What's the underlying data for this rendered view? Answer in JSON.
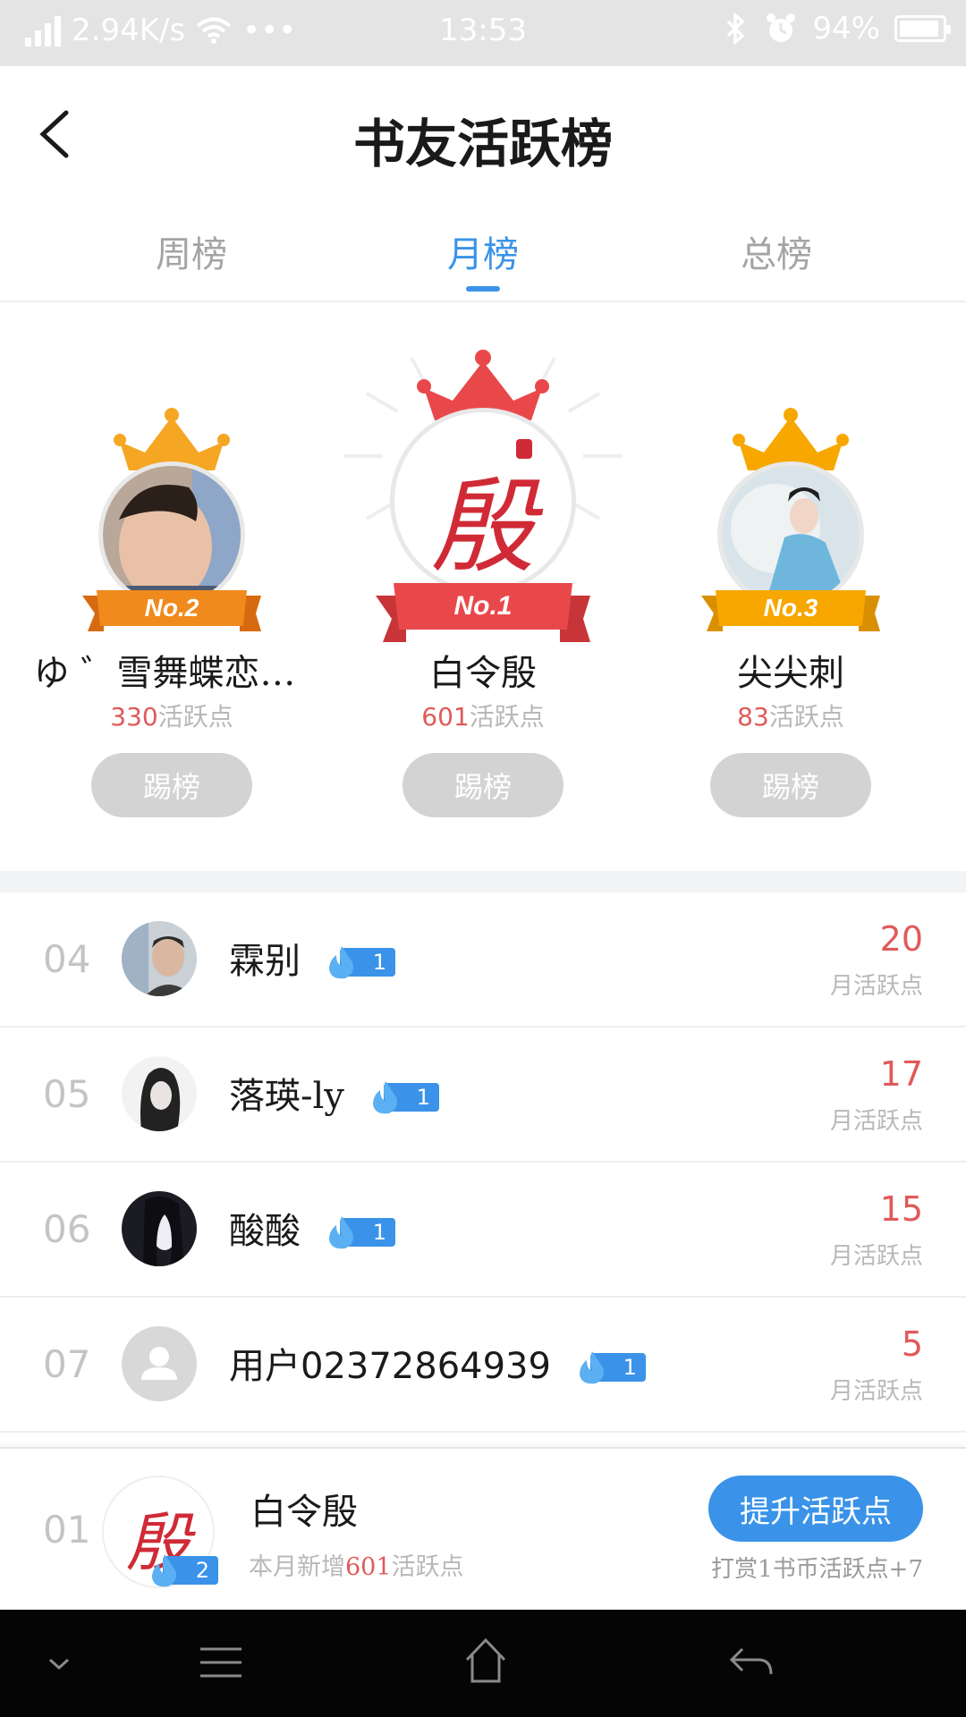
{
  "status_bar": {
    "net_speed": "2.94K/s",
    "more": "•••",
    "time": "13:53",
    "battery": "94%",
    "battery_level": 0.94
  },
  "header": {
    "title": "书友活跃榜"
  },
  "tabs": [
    {
      "label": "周榜",
      "active": false
    },
    {
      "label": "月榜",
      "active": true
    },
    {
      "label": "总榜",
      "active": false
    }
  ],
  "podium": {
    "points_suffix": "活跃点",
    "kick_label": "踢榜",
    "first": {
      "rank_label": "No.1",
      "name": "白令殷",
      "points": "601",
      "avatar_char": "殷"
    },
    "second": {
      "rank_label": "No.2",
      "name": "ゆ ゛雪舞蝶恋…",
      "points": "330"
    },
    "third": {
      "rank_label": "No.3",
      "name": "尖尖刺",
      "points": "83"
    }
  },
  "list": {
    "points_label": "月活跃点",
    "rows": [
      {
        "rank": "04",
        "name": "霖别",
        "badge": "1",
        "points": "20"
      },
      {
        "rank": "05",
        "name": "落瑛-ly",
        "badge": "1",
        "points": "17"
      },
      {
        "rank": "06",
        "name": "酸酸",
        "badge": "1",
        "points": "15"
      },
      {
        "rank": "07",
        "name": "用户02372864939",
        "badge": "1",
        "points": "5"
      }
    ]
  },
  "me": {
    "rank": "01",
    "name": "白令殷",
    "avatar_char": "殷",
    "badge": "2",
    "sub_prefix": "本月新增",
    "sub_points": "601",
    "sub_suffix": "活跃点",
    "boost_label": "提升活跃点",
    "boost_hint": "打赏1书币活跃点+7"
  },
  "colors": {
    "accent": "#3a93e8",
    "points_red": "#e05a5a",
    "gold": "#f7a700",
    "orange": "#f08a1c",
    "red": "#e9484b"
  }
}
